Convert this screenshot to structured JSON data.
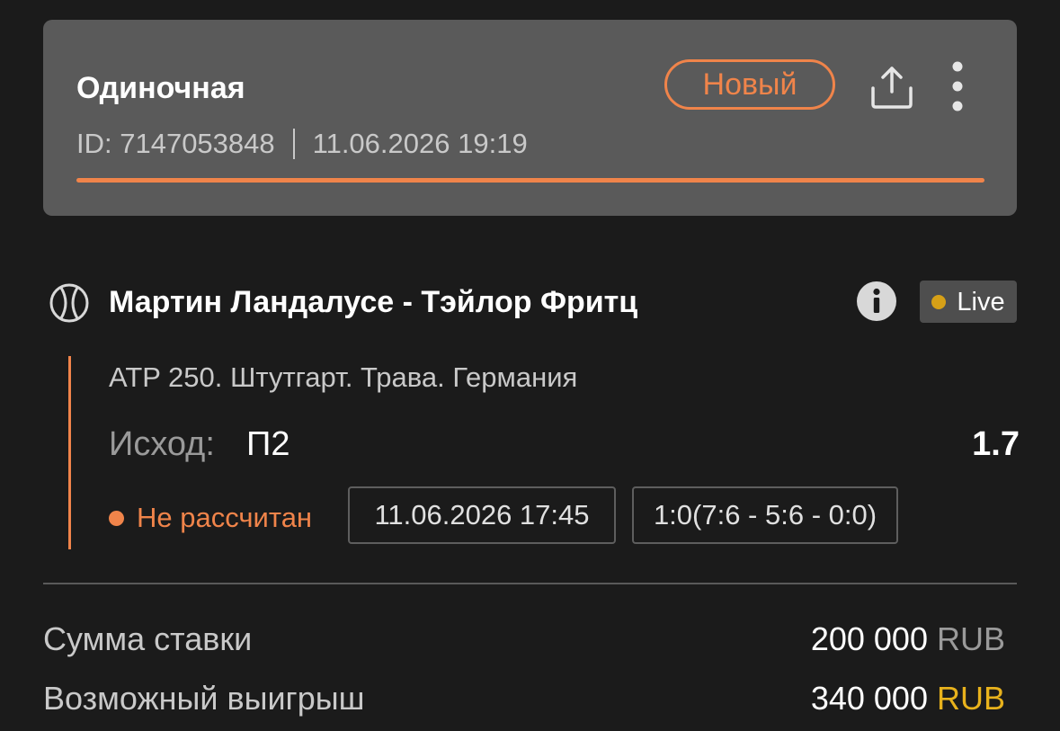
{
  "header": {
    "bet_type": "Одиночная",
    "id_label": "ID: 7147053848",
    "datetime": "11.06.2026 19:19",
    "status": "Новый",
    "progress": 1.0
  },
  "event": {
    "title": "Мартин Ландалусе - Тэйлор Фритц",
    "live_label": "Live",
    "tournament": "ATP 250. Штутгарт. Трава. Германия",
    "outcome_label": "Исход:",
    "outcome_value": "П2",
    "odds": "1.7",
    "settle_status": "Не рассчитан",
    "event_time": "11.06.2026 17:45",
    "score": "1:0(7:6 - 5:6 - 0:0)"
  },
  "summary": {
    "stake_label": "Сумма ставки",
    "stake_amount": "200 000",
    "stake_currency": "RUB",
    "win_label": "Возможный выигрыш",
    "win_amount": "340 000",
    "win_currency": "RUB"
  },
  "icons": {
    "share": "share-icon",
    "more": "more-vertical-icon",
    "sport": "tennis-ball-icon",
    "info": "info-icon"
  },
  "colors": {
    "accent": "#f0844a",
    "live_dot": "#d6a017",
    "currency_highlight": "#e8b21c",
    "card_bg": "#5a5a5a",
    "page_bg": "#1b1b1b"
  }
}
